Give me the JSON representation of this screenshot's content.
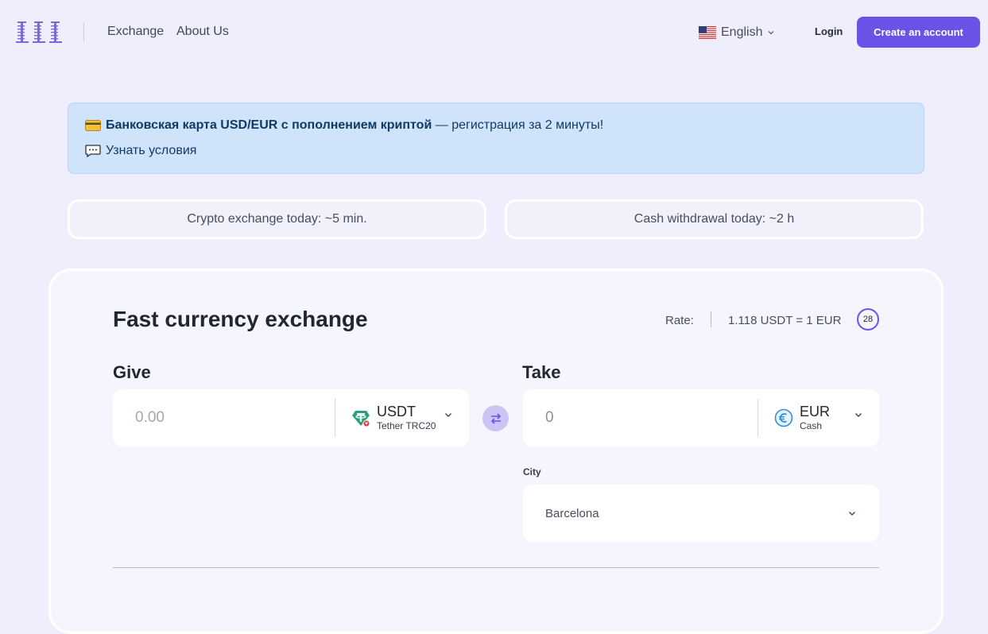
{
  "header": {
    "logo_text": "111",
    "nav": [
      "Exchange",
      "About Us"
    ],
    "language": "English",
    "login_label": "Login",
    "create_account_label": "Create an account"
  },
  "promo": {
    "line1_bold": "Банковская карта USD/EUR с пополнением криптой",
    "line1_rest": " — регистрация за 2 минуты!",
    "line2": "Узнать условия"
  },
  "status": {
    "crypto": "Crypto exchange today: ~5 min.",
    "cash": "Cash withdrawal today: ~2 h"
  },
  "exchange": {
    "title": "Fast currency exchange",
    "rate_label": "Rate:",
    "rate_value": "1.118 USDT = 1 EUR",
    "timer": "28",
    "give": {
      "label": "Give",
      "placeholder": "0.00",
      "currency_code": "USDT",
      "currency_network": "Tether TRC20"
    },
    "take": {
      "label": "Take",
      "value": "0",
      "currency_code": "EUR",
      "currency_network": "Cash"
    },
    "city_label": "City",
    "city_value": "Barcelona"
  },
  "colors": {
    "accent": "#6a52e6",
    "background": "#eeeefc",
    "promo_bg": "#cfe3fb"
  }
}
